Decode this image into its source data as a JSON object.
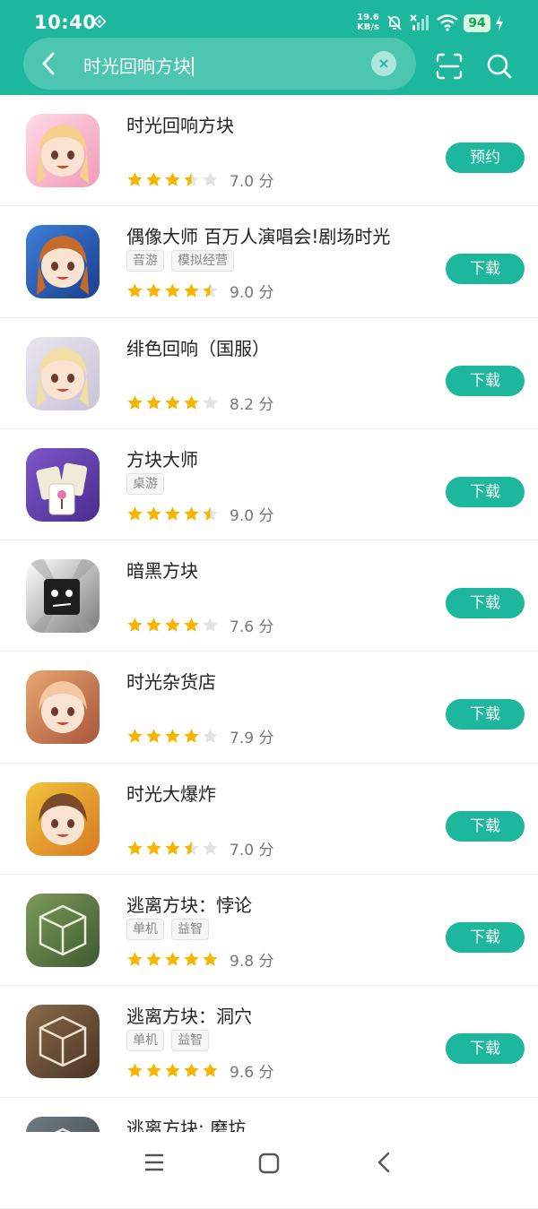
{
  "status_bar": {
    "time": "10:40",
    "net_speed": "19.6",
    "net_unit": "KB/s",
    "battery": "94"
  },
  "search": {
    "query": "时光回响方块"
  },
  "theme": {
    "accent": "#1cb79c",
    "star": "#f7b500",
    "star_empty": "#e3e3e3"
  },
  "results": [
    {
      "title": "时光回响方块",
      "tags": [],
      "stars": [
        1,
        1,
        1,
        0.5,
        0
      ],
      "score": "7.0 分",
      "button": "预约",
      "icon": {
        "bg1": "#ffd9e6",
        "bg2": "#f29ab8",
        "fg": "#f6d08a",
        "type": "girl"
      }
    },
    {
      "title": "偶像大师 百万人演唱会!剧场时光",
      "tags": [
        "音游",
        "模拟经营"
      ],
      "stars": [
        1,
        1,
        1,
        1,
        0.5
      ],
      "score": "9.0 分",
      "button": "下载",
      "icon": {
        "bg1": "#3d7fd6",
        "bg2": "#1a3f8f",
        "fg": "#c46a2a",
        "type": "girl"
      }
    },
    {
      "title": "绯色回响（国服）",
      "tags": [],
      "stars": [
        1,
        1,
        1,
        1,
        0
      ],
      "score": "8.2 分",
      "button": "下载",
      "icon": {
        "bg1": "#e9e6ee",
        "bg2": "#c9c3d6",
        "fg": "#f2dfa6",
        "type": "girl"
      }
    },
    {
      "title": "方块大师",
      "tags": [
        "桌游"
      ],
      "stars": [
        1,
        1,
        1,
        1,
        0.5
      ],
      "score": "9.0 分",
      "button": "下载",
      "icon": {
        "bg1": "#7d57c8",
        "bg2": "#4a2d8e",
        "fg": "#f1ead8",
        "type": "tiles"
      }
    },
    {
      "title": "暗黑方块",
      "tags": [],
      "stars": [
        1,
        1,
        1,
        1,
        0
      ],
      "score": "7.6 分",
      "button": "下载",
      "icon": {
        "bg1": "#ffffff",
        "bg2": "#7a7a7a",
        "fg": "#1e1e1e",
        "type": "cube-dark"
      }
    },
    {
      "title": "时光杂货店",
      "tags": [],
      "stars": [
        1,
        1,
        1,
        1,
        0
      ],
      "score": "7.9 分",
      "button": "下载",
      "icon": {
        "bg1": "#e9a772",
        "bg2": "#a8553a",
        "fg": "#f4c7a2",
        "type": "boy"
      }
    },
    {
      "title": "时光大爆炸",
      "tags": [],
      "stars": [
        1,
        1,
        1,
        0.5,
        0
      ],
      "score": "7.0 分",
      "button": "下载",
      "icon": {
        "bg1": "#f2c33b",
        "bg2": "#d77a22",
        "fg": "#7a4a2a",
        "type": "boy"
      }
    },
    {
      "title": "逃离方块：悖论",
      "tags": [
        "单机",
        "益智"
      ],
      "stars": [
        1,
        1,
        1,
        1,
        1
      ],
      "score": "9.8 分",
      "button": "下载",
      "icon": {
        "bg1": "#7c9a5a",
        "bg2": "#3f5a31",
        "fg": "#e8efd8",
        "type": "cube"
      }
    },
    {
      "title": "逃离方块：洞穴",
      "tags": [
        "单机",
        "益智"
      ],
      "stars": [
        1,
        1,
        1,
        1,
        1
      ],
      "score": "9.6 分",
      "button": "下载",
      "icon": {
        "bg1": "#8a6a4a",
        "bg2": "#4a3524",
        "fg": "#efe3d0",
        "type": "cube"
      }
    },
    {
      "title": "逃离方块: 磨坊",
      "tags": [],
      "stars": [],
      "score": "",
      "button": "",
      "icon": {
        "bg1": "#6f7b84",
        "bg2": "#3f464d",
        "fg": "#e0e6ea",
        "type": "cube"
      }
    }
  ]
}
